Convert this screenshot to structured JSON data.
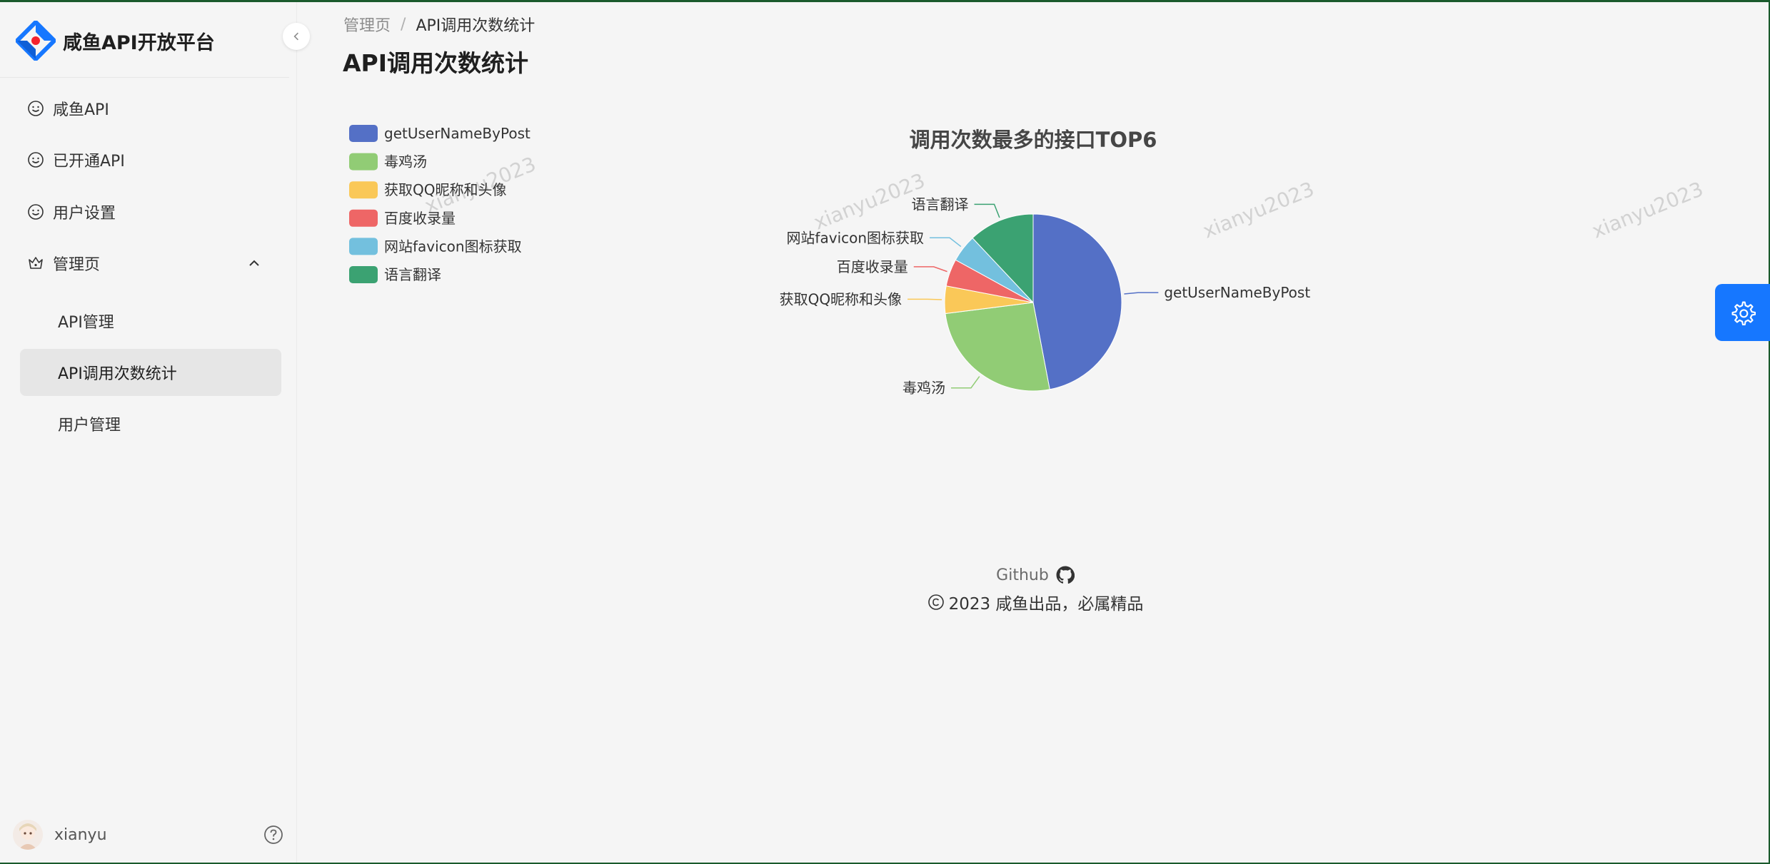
{
  "sidebar": {
    "brand_title": "咸鱼API开放平台",
    "items": [
      {
        "label": "咸鱼API"
      },
      {
        "label": "已开通API"
      },
      {
        "label": "用户设置"
      },
      {
        "label": "管理页"
      }
    ],
    "sub_items": [
      {
        "label": "API管理"
      },
      {
        "label": "API调用次数统计"
      },
      {
        "label": "用户管理"
      }
    ],
    "user": {
      "name": "xianyu"
    }
  },
  "breadcrumb": {
    "parent": "管理页",
    "separator": "/",
    "current": "API调用次数统计"
  },
  "page_title": "API调用次数统计",
  "watermark_text": "xianyu2023",
  "footer": {
    "github": "Github",
    "copyright": "2023 咸鱼出品，必属精品"
  },
  "colors": {
    "accent": "#1677ff",
    "active_menu_bg": "#e6e6e6"
  },
  "chart_data": {
    "type": "pie",
    "title": "调用次数最多的接口TOP6",
    "legend_position": "top-left",
    "slices": [
      {
        "name": "getUserNameByPost",
        "value": 47,
        "color": "#5470c6"
      },
      {
        "name": "毒鸡汤",
        "value": 26,
        "color": "#91cc75"
      },
      {
        "name": "获取QQ昵称和头像",
        "value": 5,
        "color": "#fac858"
      },
      {
        "name": "百度收录量",
        "value": 5,
        "color": "#ee6666"
      },
      {
        "name": "网站favicon图标获取",
        "value": 5,
        "color": "#73c0de"
      },
      {
        "name": "语言翻译",
        "value": 12,
        "color": "#3ba272"
      }
    ]
  }
}
